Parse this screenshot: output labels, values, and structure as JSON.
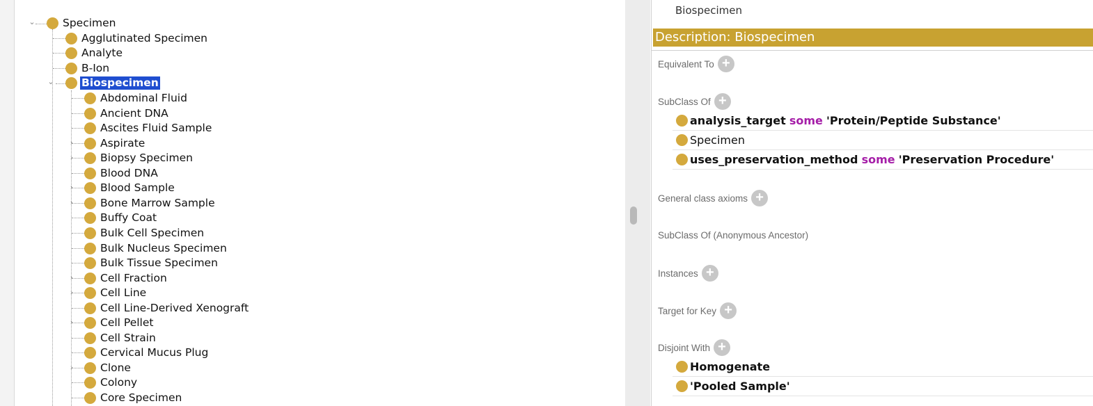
{
  "tree": {
    "root": "Specimen",
    "children": [
      {
        "label": "Agglutinated Specimen",
        "expandable": false
      },
      {
        "label": "Analyte",
        "expandable": false
      },
      {
        "label": "B-Ion",
        "expandable": false
      },
      {
        "label": "Biospecimen",
        "expandable": true,
        "expanded": true,
        "selected": true
      }
    ],
    "grandchildren": [
      {
        "label": "Abdominal Fluid",
        "expandable": false
      },
      {
        "label": "Ancient DNA",
        "expandable": false
      },
      {
        "label": "Ascites Fluid Sample",
        "expandable": false
      },
      {
        "label": "Aspirate",
        "expandable": true
      },
      {
        "label": "Biopsy Specimen",
        "expandable": true
      },
      {
        "label": "Blood DNA",
        "expandable": false
      },
      {
        "label": "Blood Sample",
        "expandable": true
      },
      {
        "label": "Bone Marrow Sample",
        "expandable": true
      },
      {
        "label": "Buffy Coat",
        "expandable": false
      },
      {
        "label": "Bulk Cell Specimen",
        "expandable": false
      },
      {
        "label": "Bulk Nucleus Specimen",
        "expandable": false
      },
      {
        "label": "Bulk Tissue Specimen",
        "expandable": false
      },
      {
        "label": "Cell Fraction",
        "expandable": true
      },
      {
        "label": "Cell Line",
        "expandable": true
      },
      {
        "label": "Cell Line-Derived Xenograft",
        "expandable": false
      },
      {
        "label": "Cell Pellet",
        "expandable": true
      },
      {
        "label": "Cell Strain",
        "expandable": false
      },
      {
        "label": "Cervical Mucus Plug",
        "expandable": false
      },
      {
        "label": "Clone",
        "expandable": true
      },
      {
        "label": "Colony",
        "expandable": false
      },
      {
        "label": "Core Specimen",
        "expandable": false
      }
    ]
  },
  "description": {
    "top_cut_text": "Biospecimen",
    "title": "Description: Biospecimen",
    "sections": {
      "equivalent_to": "Equivalent To",
      "subclass_of": "SubClass Of",
      "general_class_axioms": "General class axioms",
      "subclass_of_anon": "SubClass Of (Anonymous Ancestor)",
      "instances": "Instances",
      "target_for_key": "Target for Key",
      "disjoint_with": "Disjoint With"
    },
    "subclass_axioms": [
      {
        "prop": "analysis_target",
        "kw": "some",
        "filler": "'Protein/Peptide Substance'"
      },
      {
        "prop": "",
        "kw": "",
        "filler": "Specimen"
      },
      {
        "prop": "uses_preservation_method",
        "kw": "some",
        "filler": "'Preservation Procedure'"
      }
    ],
    "disjoint": [
      "Homogenate",
      "'Pooled Sample'"
    ]
  },
  "icons": {
    "class_dot": "class-dot-icon",
    "add": "add-icon"
  },
  "colors": {
    "class_dot": "#d4a93d",
    "header": "#c8a231",
    "selection": "#1f4ed0",
    "keyword": "#a51ea8"
  }
}
